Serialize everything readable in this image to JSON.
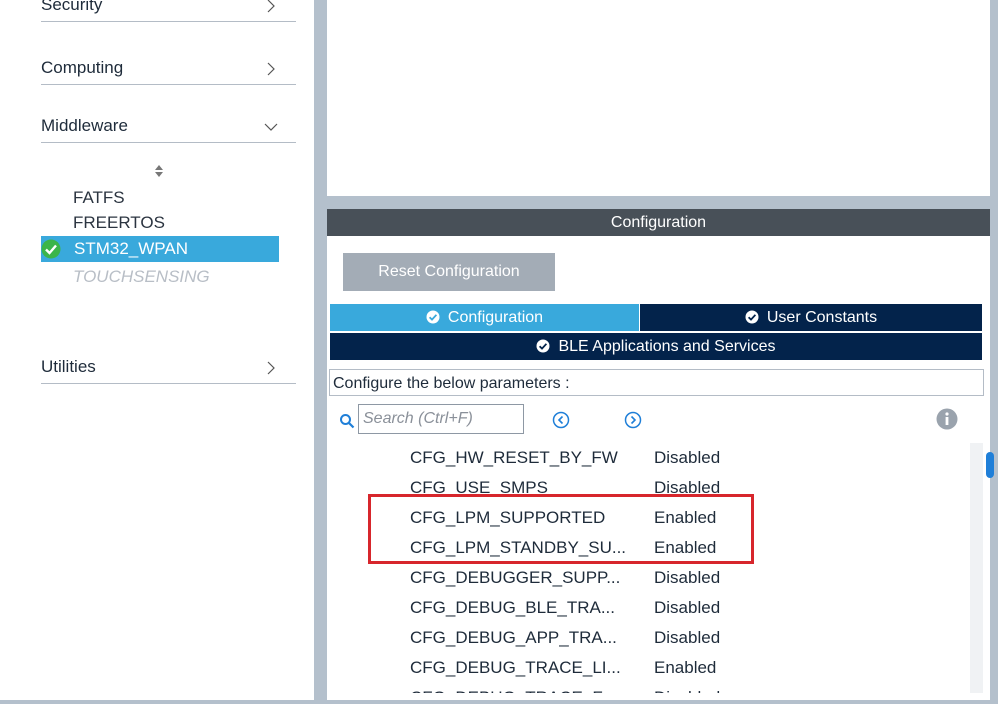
{
  "sidebar": {
    "categories": [
      {
        "label": "Security"
      },
      {
        "label": "Computing"
      },
      {
        "label": "Middleware"
      },
      {
        "label": "Utilities"
      }
    ],
    "middleware_items": [
      {
        "label": "FATFS"
      },
      {
        "label": "FREERTOS"
      },
      {
        "label": "STM32_WPAN"
      },
      {
        "label": "TOUCHSENSING"
      }
    ]
  },
  "config": {
    "header": "Configuration",
    "reset_label": "Reset Configuration",
    "tabs": [
      {
        "label": "Configuration"
      },
      {
        "label": "User Constants"
      },
      {
        "label": "BLE Applications and Services"
      }
    ],
    "caption": "Configure the below parameters :",
    "search_placeholder": "Search (Ctrl+F)",
    "params": [
      {
        "name": "CFG_HW_RESET_BY_FW",
        "value": "Disabled"
      },
      {
        "name": "CFG_USE_SMPS",
        "value": "Disabled"
      },
      {
        "name": "CFG_LPM_SUPPORTED",
        "value": "Enabled"
      },
      {
        "name": "CFG_LPM_STANDBY_SU...",
        "value": "Enabled"
      },
      {
        "name": "CFG_DEBUGGER_SUPP...",
        "value": "Disabled"
      },
      {
        "name": "CFG_DEBUG_BLE_TRA...",
        "value": "Disabled"
      },
      {
        "name": "CFG_DEBUG_APP_TRA...",
        "value": "Disabled"
      },
      {
        "name": "CFG_DEBUG_TRACE_LI...",
        "value": "Enabled"
      },
      {
        "name": "CFG_DEBUG_TRACE_F...",
        "value": "Disabled"
      }
    ]
  },
  "colors": {
    "accent_blue": "#39a9dc",
    "navy": "#03234b",
    "header_gray": "#485058",
    "highlight_red": "#d7262c"
  }
}
